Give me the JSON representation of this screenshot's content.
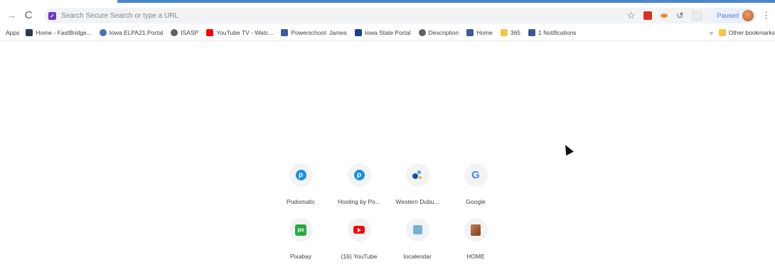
{
  "toolbar": {
    "back_icon": "arrow-right-icon",
    "reload_icon": "reload-icon",
    "omnibox_placeholder": "Search Secure Search or type a URL",
    "profile_status": "Paused"
  },
  "bookmarks": {
    "apps_label": "Apps",
    "items": [
      {
        "label": "Home - FastBridge...",
        "icon_color": "#2d3a4a"
      },
      {
        "label": "Iowa ELPA21 Portal",
        "icon_color": "#4f6fb8"
      },
      {
        "label": "ISASP",
        "icon_color": "#5f6368"
      },
      {
        "label": "YouTube TV - Watc...",
        "icon_color": "#ff0000"
      },
      {
        "label": "Powerschool: James",
        "icon_color": "#3d5a9e"
      },
      {
        "label": "Iowa State Portal",
        "icon_color": "#1f3f8f"
      },
      {
        "label": "Description",
        "icon_color": "#5f6368"
      },
      {
        "label": "Home",
        "icon_color": "#3b5998"
      },
      {
        "label": "365",
        "icon_color": "#f4c542"
      },
      {
        "label": "1 Notifications",
        "icon_color": "#3b5998"
      }
    ],
    "more": "»",
    "other_label": "Other bookmarks"
  },
  "shortcuts": [
    {
      "label": "Podomatic",
      "icon": "podomatic-icon"
    },
    {
      "label": "Hosting by Po...",
      "icon": "podomatic-icon"
    },
    {
      "label": "Western Dubu...",
      "icon": "western-dubuque-icon"
    },
    {
      "label": "Google",
      "icon": "google-icon"
    },
    {
      "label": "Pixabay",
      "icon": "pixabay-icon"
    },
    {
      "label": "(16) YouTube",
      "icon": "youtube-icon"
    },
    {
      "label": "Iocalendar",
      "icon": "calendar-icon"
    },
    {
      "label": "HOME",
      "icon": "home-photo-icon"
    }
  ],
  "colors": {
    "load_bar": "#4a86c8",
    "omnibox_bg": "#f1f3f4",
    "paused_chip": "#e8f0fe"
  }
}
